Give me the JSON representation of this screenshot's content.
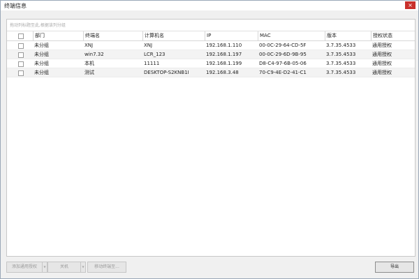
{
  "window": {
    "title": "终端信息",
    "close_icon": "×"
  },
  "group_hint": "拖动列标题至此,根据该列分组",
  "table": {
    "headers": {
      "dept": "部门",
      "terminal": "终端名",
      "computer": "计算机名",
      "ip": "IP",
      "mac": "MAC",
      "version": "版本",
      "license": "授权状态"
    },
    "rows": [
      {
        "dept": "未分组",
        "terminal": "XNJ",
        "computer": "XNJ",
        "ip": "192.168.1.110",
        "mac": "00-0C-29-64-CD-5F",
        "version": "3.7.35.4533",
        "license": "通用授权"
      },
      {
        "dept": "未分组",
        "terminal": "win7.32",
        "computer": "LCR_123",
        "ip": "192.168.1.197",
        "mac": "00-0C-29-6D-9B-95",
        "version": "3.7.35.4533",
        "license": "通用授权"
      },
      {
        "dept": "未分组",
        "terminal": "本机",
        "computer": "11111",
        "ip": "192.168.1.199",
        "mac": "D8-C4-97-6B-05-06",
        "version": "3.7.35.4533",
        "license": "通用授权"
      },
      {
        "dept": "未分组",
        "terminal": "测试",
        "computer": "DESKTOP-S2KNB1I",
        "ip": "192.168.3.48",
        "mac": "70-C9-4E-D2-41-C1",
        "version": "3.7.35.4533",
        "license": "通用授权"
      }
    ]
  },
  "buttons": {
    "add_license": "添加通用授权",
    "shutdown": "关机",
    "move_terminal": "移动终端至...",
    "export": "导出"
  }
}
